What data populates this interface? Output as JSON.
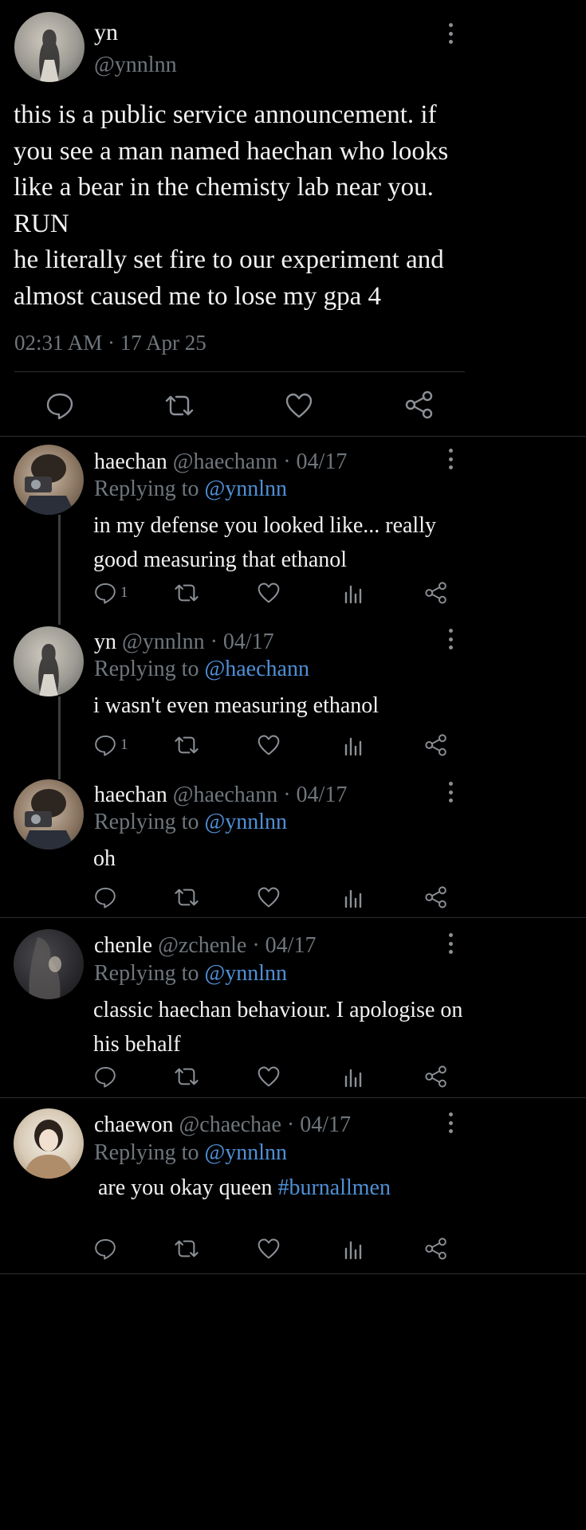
{
  "main_post": {
    "display_name": "yn",
    "handle": "@ynnlnn",
    "text_lines": [
      "this is a public service announcement. if",
      "you see a man named haechan who looks",
      "like a bear in the chemisty lab near you.",
      "RUN",
      "he literally set fire to our experiment and",
      "almost caused me to lose my gpa 4"
    ],
    "timestamp": "02:31 AM · 17 Apr 25"
  },
  "replies": [
    {
      "name": "haechan",
      "handle": "@haechann",
      "date": "· 04/17",
      "replying_prefix": "Replying to",
      "replying_to": "@ynnlnn",
      "text_lines": [
        "in my defense you looked like... really",
        "good measuring that ethanol"
      ],
      "reply_count": "1"
    },
    {
      "name": "yn",
      "handle": "@ynnlnn",
      "date": "· 04/17",
      "replying_prefix": "Replying to",
      "replying_to": "@haechann",
      "text_lines": [
        "i wasn't even measuring ethanol"
      ],
      "reply_count": "1"
    },
    {
      "name": "haechan",
      "handle": "@haechann",
      "date": "· 04/17",
      "replying_prefix": "Replying to",
      "replying_to": "@ynnlnn",
      "text_lines": [
        "oh"
      ],
      "reply_count": ""
    },
    {
      "name": "chenle",
      "handle": "@zchenle",
      "date": "· 04/17",
      "replying_prefix": "Replying to",
      "replying_to": "@ynnlnn",
      "text_lines": [
        "classic haechan behaviour. I apologise on",
        "his behalf"
      ],
      "reply_count": ""
    },
    {
      "name": "chaewon",
      "handle": "@chaechae",
      "date": "· 04/17",
      "replying_prefix": "Replying to",
      "replying_to": "@ynnlnn",
      "text_plain": "are you okay queen",
      "text_hashtag": "#burnallmen",
      "reply_count": ""
    }
  ],
  "colors": {
    "background": "#000000",
    "text": "#f2f2f2",
    "muted": "#6f767c",
    "link": "#4f90d6",
    "icon": "#8b9096",
    "divider": "#2a2d30"
  },
  "icons": [
    "more-vert-icon",
    "reply-icon",
    "retweet-icon",
    "like-icon",
    "analytics-icon",
    "share-icon"
  ]
}
